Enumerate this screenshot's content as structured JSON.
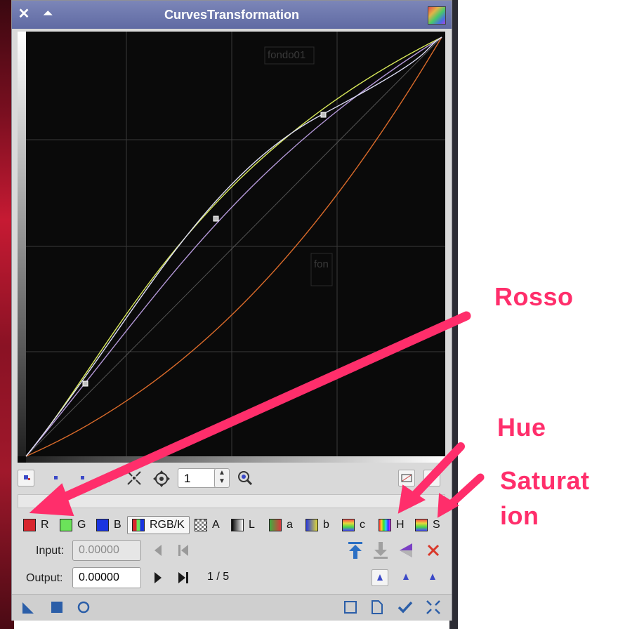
{
  "window": {
    "title": "CurvesTransformation"
  },
  "toolbar": {
    "zoom_value": "1"
  },
  "channels": [
    {
      "label": "R",
      "color": "#d9272e"
    },
    {
      "label": "G",
      "color": "#6be35a"
    },
    {
      "label": "B",
      "color": "#1a34e0"
    },
    {
      "label": "RGB/K"
    },
    {
      "label": "A"
    },
    {
      "label": "L"
    },
    {
      "label": "a"
    },
    {
      "label": "b"
    },
    {
      "label": "c"
    },
    {
      "label": "H"
    },
    {
      "label": "S"
    }
  ],
  "point_editor": {
    "input_label": "Input:",
    "input_value": "0.00000",
    "output_label": "Output:",
    "output_value": "0.00000",
    "counter": "1 / 5"
  },
  "background_labels": {
    "window_1": "fondo01",
    "window_2": "fon"
  },
  "annotations": {
    "rosso": "Rosso",
    "hue": "Hue",
    "saturation_line1": "Saturat",
    "saturation_line2": "ion"
  },
  "colors": {
    "accent": "#ff2e6b",
    "title_bar": "#6b75ad",
    "curve_rgbk": "#c9c9ff",
    "curve_green": "#d8e85a",
    "curve_red": "#d96a2a"
  }
}
